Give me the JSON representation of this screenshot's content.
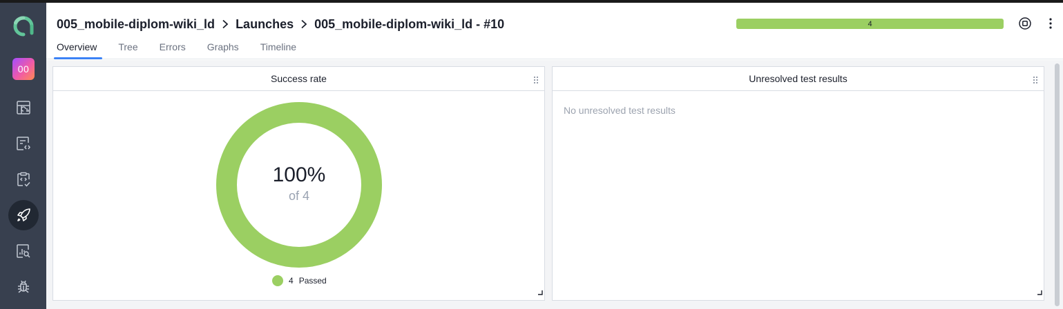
{
  "colors": {
    "sidebar": "#38404f",
    "accent": "#3b82f6",
    "passed": "#9bcf62",
    "logo": "#62c59a"
  },
  "sidebar": {
    "project_badge": "00",
    "items": [
      {
        "name": "dashboards-icon"
      },
      {
        "name": "test-cases-icon"
      },
      {
        "name": "test-plans-icon"
      },
      {
        "name": "launches-icon",
        "active": true
      },
      {
        "name": "analytics-icon"
      },
      {
        "name": "defects-icon"
      }
    ]
  },
  "header": {
    "breadcrumb": [
      "005_mobile-diplom-wiki_ld",
      "Launches",
      "005_mobile-diplom-wiki_ld - #10"
    ],
    "tabs": [
      {
        "label": "Overview",
        "active": true
      },
      {
        "label": "Tree"
      },
      {
        "label": "Errors"
      },
      {
        "label": "Graphs"
      },
      {
        "label": "Timeline"
      }
    ],
    "progress_label": "4",
    "progress_passed_fraction": 1.0
  },
  "widgets": {
    "success_rate": {
      "title": "Success rate",
      "percent_text": "100%",
      "of_text": "of 4",
      "legend_count": "4",
      "legend_label": "Passed"
    },
    "unresolved": {
      "title": "Unresolved test results",
      "empty_text": "No unresolved test results"
    }
  }
}
